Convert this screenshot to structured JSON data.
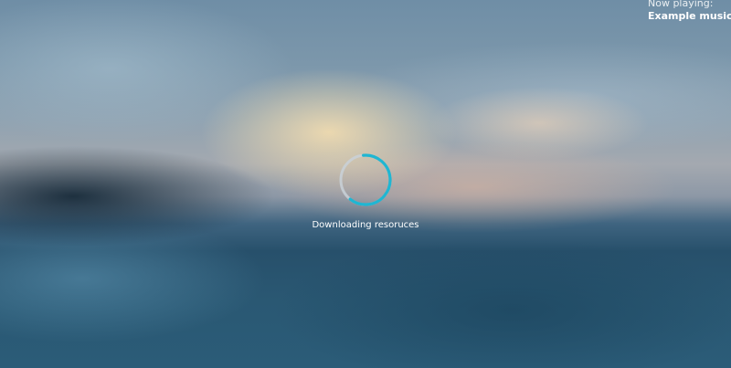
{
  "now_playing": {
    "label": "Now playing:",
    "track": "Example music track"
  },
  "loader": {
    "status_text": "Downloading resoruces",
    "accent_color": "#1fb6d2",
    "track_color": "#c9d1d8",
    "icon": "spinner-icon"
  }
}
